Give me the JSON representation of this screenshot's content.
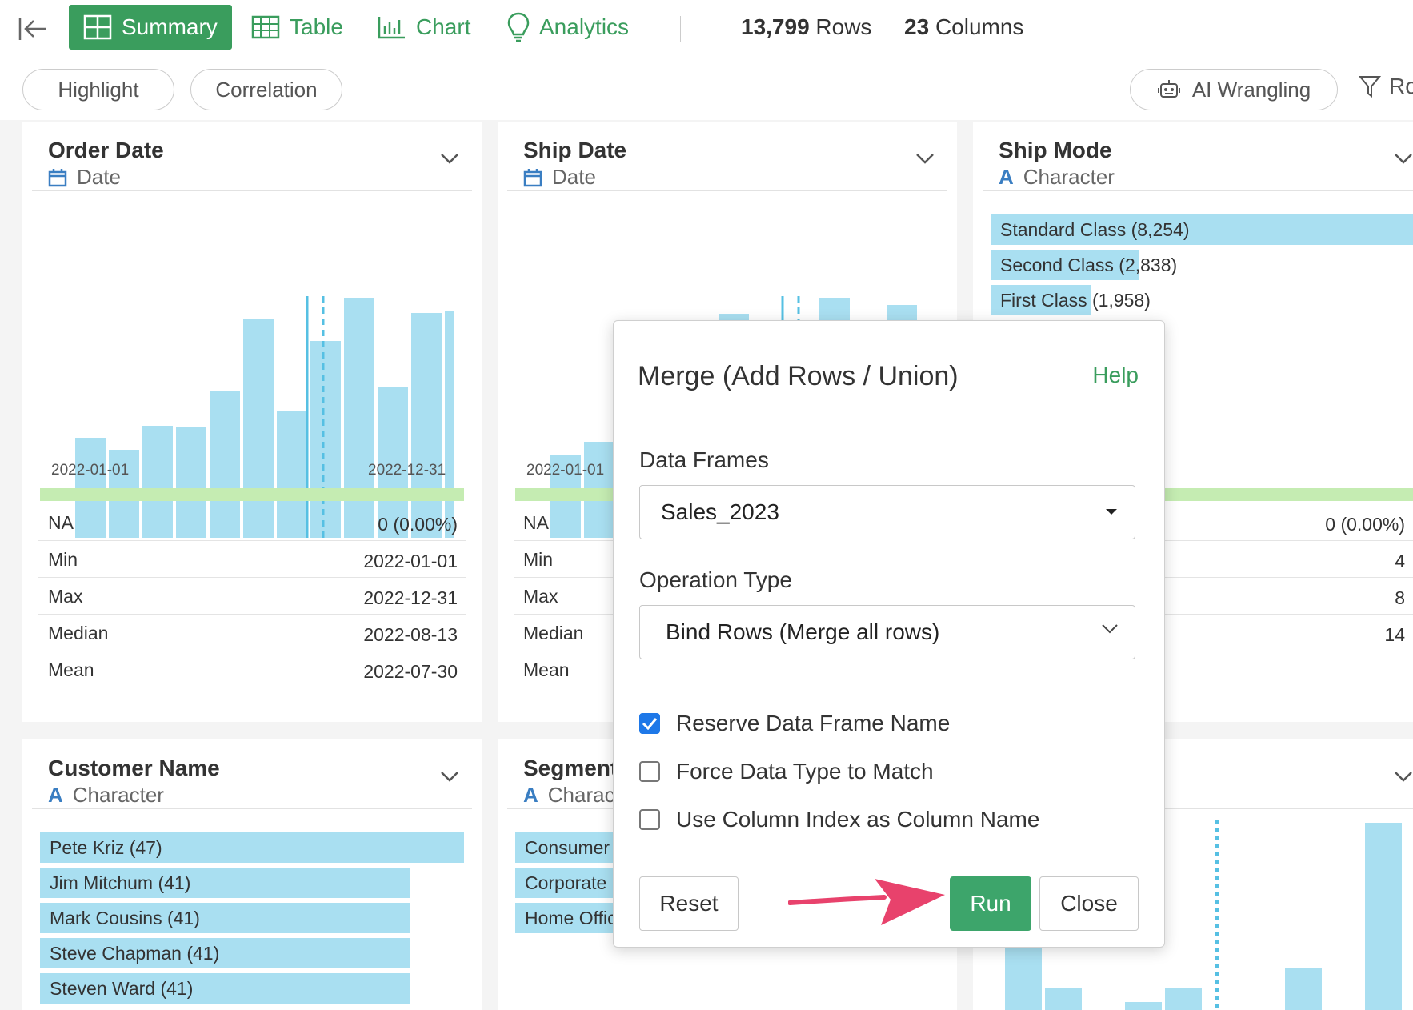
{
  "topbar": {
    "tabs": [
      {
        "label": "Summary",
        "icon": "summary-grid-icon",
        "active": true
      },
      {
        "label": "Table",
        "icon": "table-icon",
        "active": false
      },
      {
        "label": "Chart",
        "icon": "chart-icon",
        "active": false
      },
      {
        "label": "Analytics",
        "icon": "lightbulb-icon",
        "active": false
      }
    ],
    "rows_num": "13,799",
    "rows_word": "Rows",
    "cols_num": "23",
    "cols_word": "Columns"
  },
  "subbar": {
    "highlight": "Highlight",
    "correlation": "Correlation",
    "ai_wrangling": "AI Wrangling",
    "filter_partial": "Ro"
  },
  "cards": {
    "order_date": {
      "title": "Order Date",
      "type": "Date",
      "axis_start": "2022-01-01",
      "axis_end": "2022-12-31",
      "stats": [
        {
          "k": "NA",
          "v": "0 (0.00%)"
        },
        {
          "k": "Min",
          "v": "2022-01-01"
        },
        {
          "k": "Max",
          "v": "2022-12-31"
        },
        {
          "k": "Median",
          "v": "2022-08-13"
        },
        {
          "k": "Mean",
          "v": "2022-07-30"
        }
      ]
    },
    "ship_date": {
      "title": "Ship Date",
      "type": "Date",
      "axis_start": "2022-01-01",
      "stats": [
        {
          "k": "NA"
        },
        {
          "k": "Min"
        },
        {
          "k": "Max"
        },
        {
          "k": "Median"
        },
        {
          "k": "Mean"
        }
      ]
    },
    "ship_mode": {
      "title": "Ship Mode",
      "type": "Character",
      "bars": [
        {
          "label": "Standard Class (8,254)"
        },
        {
          "label": "Second Class (2,838)"
        },
        {
          "label": "First Class (1,958)"
        }
      ],
      "stat_values": [
        "0 (0.00%)",
        "4",
        "8",
        "14"
      ]
    },
    "customer_name": {
      "title": "Customer Name",
      "type": "Character",
      "bars": [
        {
          "label": "Pete Kriz (47)"
        },
        {
          "label": "Jim Mitchum (41)"
        },
        {
          "label": "Mark Cousins (41)"
        },
        {
          "label": "Steve Chapman (41)"
        },
        {
          "label": "Steven Ward (41)"
        }
      ]
    },
    "segment": {
      "title": "Segment",
      "type": "Character",
      "bars": [
        {
          "label": "Consumer"
        },
        {
          "label": "Corporate"
        },
        {
          "label": "Home Office"
        }
      ]
    }
  },
  "modal": {
    "title": "Merge (Add Rows / Union)",
    "help": "Help",
    "data_frames_label": "Data Frames",
    "data_frames_value": "Sales_2023",
    "operation_type_label": "Operation Type",
    "operation_type_value": "Bind Rows (Merge all rows)",
    "checkboxes": [
      {
        "label": "Reserve Data Frame Name",
        "checked": true
      },
      {
        "label": "Force Data Type to Match",
        "checked": false
      },
      {
        "label": "Use Column Index as Column Name",
        "checked": false
      }
    ],
    "reset": "Reset",
    "run": "Run",
    "close": "Close"
  },
  "colors": {
    "accent_green": "#3a9d5d",
    "bar_blue": "#a9dff1",
    "annotation_arrow": "#e8426c",
    "checkbox_blue": "#1e78e8"
  }
}
